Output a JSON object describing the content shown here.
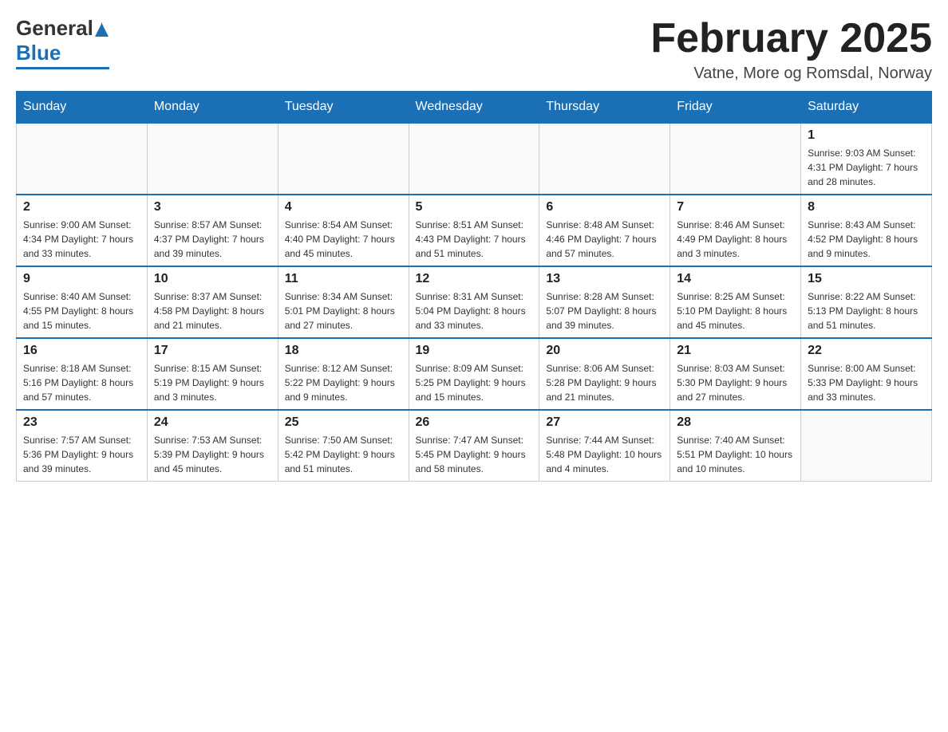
{
  "logo": {
    "general": "General",
    "blue": "Blue",
    "underline": true
  },
  "header": {
    "month_title": "February 2025",
    "location": "Vatne, More og Romsdal, Norway"
  },
  "days_of_week": [
    "Sunday",
    "Monday",
    "Tuesday",
    "Wednesday",
    "Thursday",
    "Friday",
    "Saturday"
  ],
  "weeks": [
    [
      {
        "day": "",
        "info": ""
      },
      {
        "day": "",
        "info": ""
      },
      {
        "day": "",
        "info": ""
      },
      {
        "day": "",
        "info": ""
      },
      {
        "day": "",
        "info": ""
      },
      {
        "day": "",
        "info": ""
      },
      {
        "day": "1",
        "info": "Sunrise: 9:03 AM\nSunset: 4:31 PM\nDaylight: 7 hours\nand 28 minutes."
      }
    ],
    [
      {
        "day": "2",
        "info": "Sunrise: 9:00 AM\nSunset: 4:34 PM\nDaylight: 7 hours\nand 33 minutes."
      },
      {
        "day": "3",
        "info": "Sunrise: 8:57 AM\nSunset: 4:37 PM\nDaylight: 7 hours\nand 39 minutes."
      },
      {
        "day": "4",
        "info": "Sunrise: 8:54 AM\nSunset: 4:40 PM\nDaylight: 7 hours\nand 45 minutes."
      },
      {
        "day": "5",
        "info": "Sunrise: 8:51 AM\nSunset: 4:43 PM\nDaylight: 7 hours\nand 51 minutes."
      },
      {
        "day": "6",
        "info": "Sunrise: 8:48 AM\nSunset: 4:46 PM\nDaylight: 7 hours\nand 57 minutes."
      },
      {
        "day": "7",
        "info": "Sunrise: 8:46 AM\nSunset: 4:49 PM\nDaylight: 8 hours\nand 3 minutes."
      },
      {
        "day": "8",
        "info": "Sunrise: 8:43 AM\nSunset: 4:52 PM\nDaylight: 8 hours\nand 9 minutes."
      }
    ],
    [
      {
        "day": "9",
        "info": "Sunrise: 8:40 AM\nSunset: 4:55 PM\nDaylight: 8 hours\nand 15 minutes."
      },
      {
        "day": "10",
        "info": "Sunrise: 8:37 AM\nSunset: 4:58 PM\nDaylight: 8 hours\nand 21 minutes."
      },
      {
        "day": "11",
        "info": "Sunrise: 8:34 AM\nSunset: 5:01 PM\nDaylight: 8 hours\nand 27 minutes."
      },
      {
        "day": "12",
        "info": "Sunrise: 8:31 AM\nSunset: 5:04 PM\nDaylight: 8 hours\nand 33 minutes."
      },
      {
        "day": "13",
        "info": "Sunrise: 8:28 AM\nSunset: 5:07 PM\nDaylight: 8 hours\nand 39 minutes."
      },
      {
        "day": "14",
        "info": "Sunrise: 8:25 AM\nSunset: 5:10 PM\nDaylight: 8 hours\nand 45 minutes."
      },
      {
        "day": "15",
        "info": "Sunrise: 8:22 AM\nSunset: 5:13 PM\nDaylight: 8 hours\nand 51 minutes."
      }
    ],
    [
      {
        "day": "16",
        "info": "Sunrise: 8:18 AM\nSunset: 5:16 PM\nDaylight: 8 hours\nand 57 minutes."
      },
      {
        "day": "17",
        "info": "Sunrise: 8:15 AM\nSunset: 5:19 PM\nDaylight: 9 hours\nand 3 minutes."
      },
      {
        "day": "18",
        "info": "Sunrise: 8:12 AM\nSunset: 5:22 PM\nDaylight: 9 hours\nand 9 minutes."
      },
      {
        "day": "19",
        "info": "Sunrise: 8:09 AM\nSunset: 5:25 PM\nDaylight: 9 hours\nand 15 minutes."
      },
      {
        "day": "20",
        "info": "Sunrise: 8:06 AM\nSunset: 5:28 PM\nDaylight: 9 hours\nand 21 minutes."
      },
      {
        "day": "21",
        "info": "Sunrise: 8:03 AM\nSunset: 5:30 PM\nDaylight: 9 hours\nand 27 minutes."
      },
      {
        "day": "22",
        "info": "Sunrise: 8:00 AM\nSunset: 5:33 PM\nDaylight: 9 hours\nand 33 minutes."
      }
    ],
    [
      {
        "day": "23",
        "info": "Sunrise: 7:57 AM\nSunset: 5:36 PM\nDaylight: 9 hours\nand 39 minutes."
      },
      {
        "day": "24",
        "info": "Sunrise: 7:53 AM\nSunset: 5:39 PM\nDaylight: 9 hours\nand 45 minutes."
      },
      {
        "day": "25",
        "info": "Sunrise: 7:50 AM\nSunset: 5:42 PM\nDaylight: 9 hours\nand 51 minutes."
      },
      {
        "day": "26",
        "info": "Sunrise: 7:47 AM\nSunset: 5:45 PM\nDaylight: 9 hours\nand 58 minutes."
      },
      {
        "day": "27",
        "info": "Sunrise: 7:44 AM\nSunset: 5:48 PM\nDaylight: 10 hours\nand 4 minutes."
      },
      {
        "day": "28",
        "info": "Sunrise: 7:40 AM\nSunset: 5:51 PM\nDaylight: 10 hours\nand 10 minutes."
      },
      {
        "day": "",
        "info": ""
      }
    ]
  ]
}
